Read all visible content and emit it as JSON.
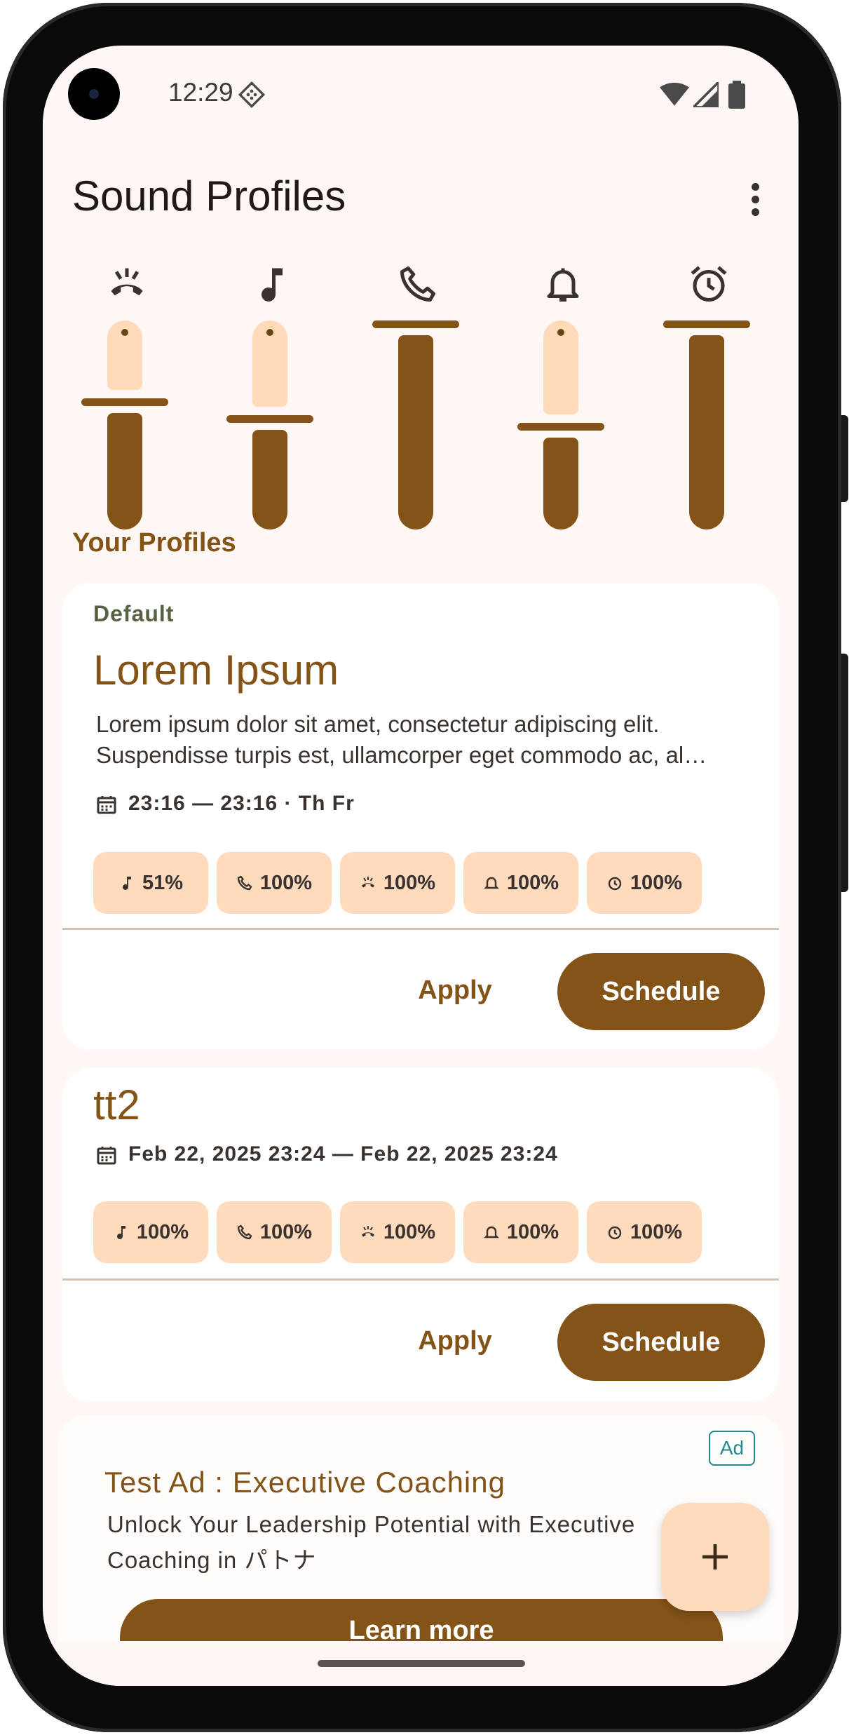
{
  "status_bar": {
    "time": "12:29"
  },
  "app_bar": {
    "title": "Sound Profiles"
  },
  "volume_sliders": [
    {
      "icon": "call-end-icon",
      "level": 0.53
    },
    {
      "icon": "music-note-icon",
      "level": 0.43
    },
    {
      "icon": "phone-icon",
      "level": 1.0
    },
    {
      "icon": "bell-icon",
      "level": 0.38
    },
    {
      "icon": "alarm-clock-icon",
      "level": 1.0
    }
  ],
  "section": {
    "label": "Your Profiles"
  },
  "profiles": [
    {
      "badge": "Default",
      "title": "Lorem Ipsum",
      "description": "Lorem ipsum dolor sit amet, consectetur adipiscing elit. Suspendisse turpis est, ullamcorper eget commodo ac, al…",
      "schedule": "23:16 — 23:16 · Th Fr",
      "chips": [
        {
          "icon": "music-note-icon",
          "value": "51%"
        },
        {
          "icon": "phone-icon",
          "value": "100%"
        },
        {
          "icon": "call-end-icon",
          "value": "100%"
        },
        {
          "icon": "bell-icon",
          "value": "100%"
        },
        {
          "icon": "alarm-clock-icon",
          "value": "100%"
        }
      ],
      "apply_label": "Apply",
      "schedule_label": "Schedule"
    },
    {
      "title": "tt2",
      "schedule": "Feb 22, 2025 23:24 — Feb 22, 2025 23:24",
      "chips": [
        {
          "icon": "music-note-icon",
          "value": "100%"
        },
        {
          "icon": "phone-icon",
          "value": "100%"
        },
        {
          "icon": "call-end-icon",
          "value": "100%"
        },
        {
          "icon": "bell-icon",
          "value": "100%"
        },
        {
          "icon": "alarm-clock-icon",
          "value": "100%"
        }
      ],
      "apply_label": "Apply",
      "schedule_label": "Schedule"
    }
  ],
  "ad": {
    "badge": "Ad",
    "title": "Test Ad : Executive Coaching",
    "body": "Unlock Your Leadership Potential with Executive Coaching in パトナ",
    "button": "Learn more"
  },
  "colors": {
    "primary": "#845318",
    "chip": "#ffdbbd",
    "background": "#fff7f3"
  }
}
